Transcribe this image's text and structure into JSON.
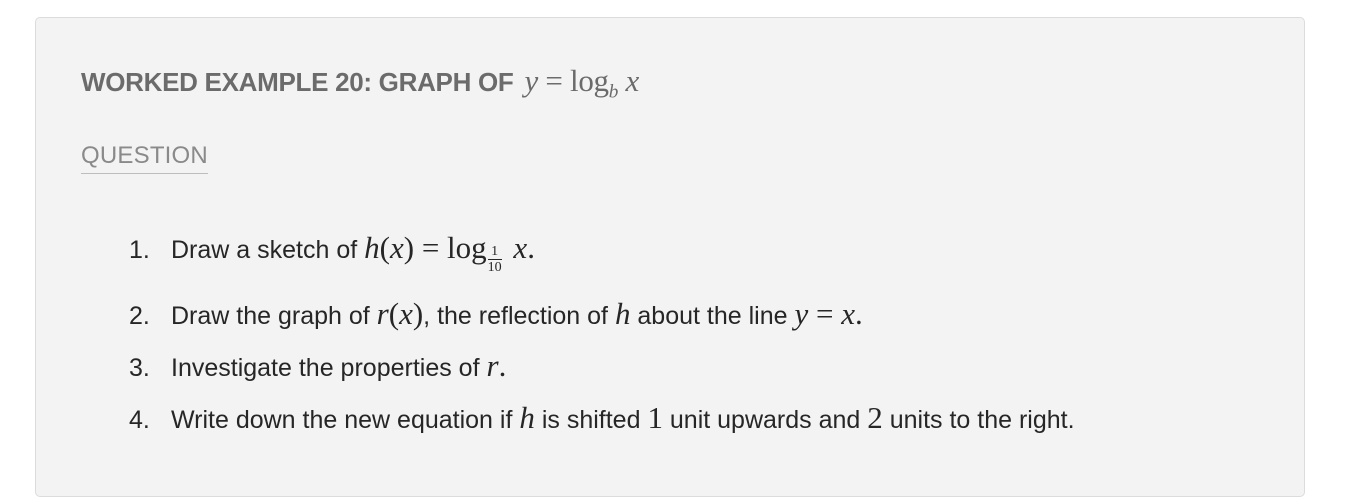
{
  "heading": {
    "text": "WORKED EXAMPLE 20: GRAPH OF",
    "math_y": "y",
    "math_eq": "=",
    "math_log": "log",
    "math_base": "b",
    "math_x": "x"
  },
  "question_label": "QUESTION",
  "items": [
    {
      "number": "1.",
      "text_a": "Draw a sketch of",
      "math_h": "h",
      "math_x": "x",
      "math_eq": "=",
      "math_log": "log",
      "frac_num": "1",
      "frac_den": "10",
      "math_x2": "x",
      "period": "."
    },
    {
      "number": "2.",
      "text_a": "Draw the graph of",
      "math_r": "r",
      "math_x": "x",
      "text_b": ", the reflection of",
      "math_h": "h",
      "text_c": "about the line",
      "math_y": "y",
      "math_eq": "=",
      "math_x2": "x",
      "period": "."
    },
    {
      "number": "3.",
      "text_a": "Investigate the properties of",
      "math_r": "r",
      "period": "."
    },
    {
      "number": "4.",
      "text_a": "Write down the new equation if",
      "math_h": "h",
      "text_b": "is shifted",
      "math_1": "1",
      "text_c": "unit upwards and",
      "math_2": "2",
      "text_d": "units to the right."
    }
  ]
}
